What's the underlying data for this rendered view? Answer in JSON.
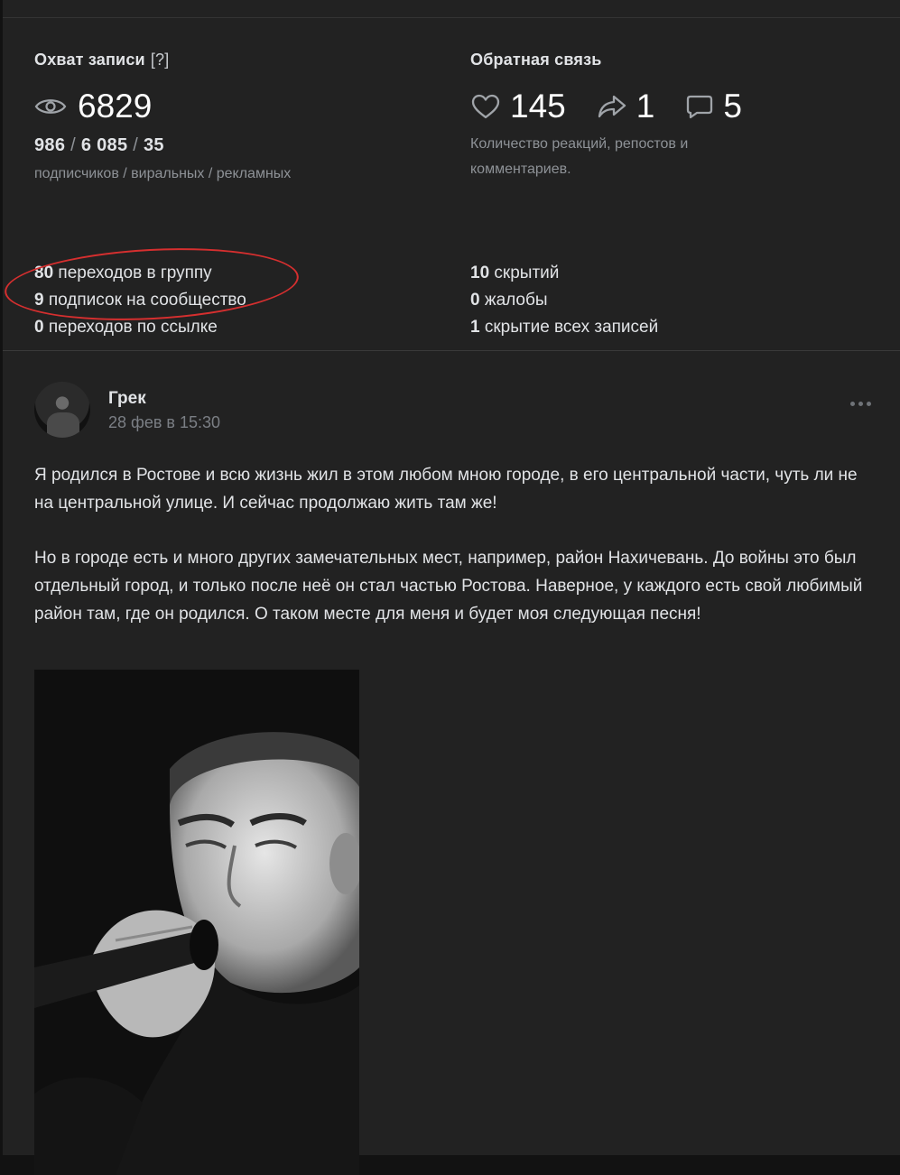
{
  "stats": {
    "reach_title": "Охват записи",
    "reach_help": "[?]",
    "views": "6829",
    "reach_breakdown": {
      "subscribers": "986",
      "viral": "6 085",
      "ads": "35",
      "separator": " / "
    },
    "reach_caption": "подписчиков / виральных / рекламных",
    "feedback_title": "Обратная связь",
    "likes": "145",
    "reposts": "1",
    "comments": "5",
    "feedback_caption": "Количество реакций, репостов и комментариев.",
    "left_lines": [
      {
        "num": "80",
        "text": " переходов в группу"
      },
      {
        "num": "9",
        "text": " подписок на сообщество"
      },
      {
        "num": "0",
        "text": " переходов по ссылке"
      }
    ],
    "right_lines": [
      {
        "num": "10",
        "text": " скрытий"
      },
      {
        "num": "0",
        "text": " жалобы"
      },
      {
        "num": "1",
        "text": " скрытие всех записей"
      }
    ],
    "highlight_color": "#d62f2f"
  },
  "post": {
    "author": "Грек",
    "date": "28 фев в 15:30",
    "paragraphs": [
      "Я родился в Ростове и всю жизнь жил в этом любом мною городе, в его центральной части, чуть ли не на центральной улице. И сейчас продолжаю жить там же!",
      "Но в городе есть и много других замечательных мест, например, район Нахичевань. До войны это был отдельный город, и только после неё он стал частью Ростова. Наверное, у каждого есть свой любимый район там, где он родился. О таком месте для меня и будет моя следующая песня!"
    ]
  },
  "icons": {
    "views": "eye-icon",
    "likes": "heart-icon",
    "reposts": "share-icon",
    "comments": "comment-icon",
    "more": "more-dots-icon"
  }
}
